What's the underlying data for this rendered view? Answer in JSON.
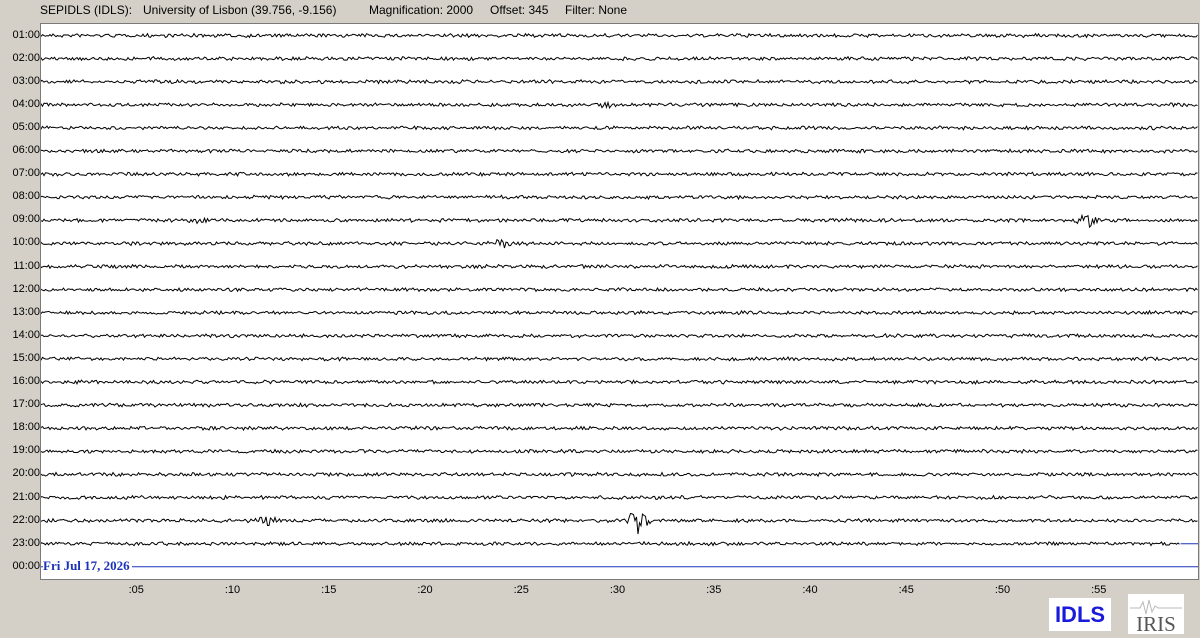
{
  "header": {
    "station": "SEPIDLS (IDLS):",
    "location": "University of Lisbon (39.756, -9.156)",
    "magnification": "Magnification: 2000",
    "offset": "Offset: 345",
    "filter": "Filter: None"
  },
  "helicorder": {
    "hour_labels": [
      "01:00",
      "02:00",
      "03:00",
      "04:00",
      "05:00",
      "06:00",
      "07:00",
      "08:00",
      "09:00",
      "10:00",
      "11:00",
      "12:00",
      "13:00",
      "14:00",
      "15:00",
      "16:00",
      "17:00",
      "18:00",
      "19:00",
      "20:00",
      "21:00",
      "22:00",
      "23:00",
      "00:00"
    ],
    "date": "Fri Jul 17, 2026",
    "minute_labels": [
      ":05",
      ":10",
      ":15",
      ":20",
      ":25",
      ":30",
      ":35",
      ":40",
      ":45",
      ":50",
      ":55"
    ],
    "trace_color": "#000000",
    "current_time_color": "#1a33b8",
    "last_trace_end_fraction": 0.985,
    "events": [
      {
        "row": 3,
        "minute": 29.3,
        "amplitude": 3
      },
      {
        "row": 8,
        "minute": 8.0,
        "amplitude": 4
      },
      {
        "row": 8,
        "minute": 54.3,
        "amplitude": 7
      },
      {
        "row": 9,
        "minute": 23.9,
        "amplitude": 5
      },
      {
        "row": 21,
        "minute": 31.0,
        "amplitude": 14
      },
      {
        "row": 21,
        "minute": 11.8,
        "amplitude": 4
      }
    ]
  },
  "logos": {
    "idls": "IDLS",
    "iris": "IRIS"
  }
}
